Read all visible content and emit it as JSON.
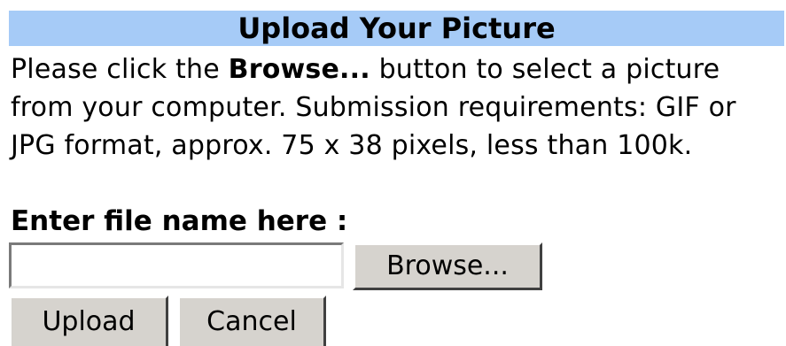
{
  "header": {
    "title": "Upload Your Picture"
  },
  "instructions": {
    "before_bold": "Please click the ",
    "bold": "Browse...",
    "after_bold": " button to select a picture from your computer. Submission requirements: GIF or JPG format, approx. 75 x 38 pixels, less than 100k."
  },
  "form": {
    "file_label": "Enter file name here :",
    "file_value": "",
    "browse_label": "Browse...",
    "upload_label": "Upload",
    "cancel_label": "Cancel"
  },
  "colors": {
    "title_background": "#a6cbf7",
    "button_face": "#d6d3ce"
  }
}
